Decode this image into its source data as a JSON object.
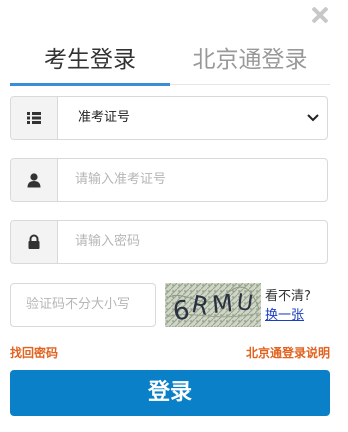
{
  "tabs": {
    "active": "考生登录",
    "inactive": "北京通登录"
  },
  "form": {
    "id_type_select": {
      "selected": "准考证号"
    },
    "username_placeholder": "请输入准考证号",
    "password_placeholder": "请输入密码",
    "captcha_placeholder": "验证码不分大小写",
    "captcha_text": "6RMU",
    "captcha_unclear": "看不清?",
    "captcha_refresh": "换一张"
  },
  "links": {
    "forgot_password": "找回密码",
    "beijingtong_help": "北京通登录说明"
  },
  "login_button": "登录",
  "colors": {
    "accent_blue": "#0a80c8",
    "tab_underline": "#3a8ed6",
    "link_orange": "#e2621f"
  }
}
